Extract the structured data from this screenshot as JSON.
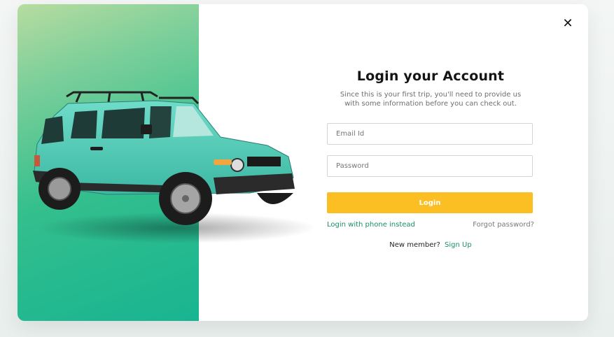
{
  "modal": {
    "close_icon": "close-icon",
    "title": "Login your Account",
    "subtitle": "Since this is your first trip, you'll need to provide us with some information before you can check out.",
    "email_placeholder": "Email Id",
    "email_value": "",
    "password_placeholder": "Password",
    "password_value": "",
    "login_label": "Login",
    "phone_login_label": "Login with phone instead",
    "forgot_label": "Forgot password?",
    "new_member_label": "New member?",
    "signup_label": "Sign Up"
  },
  "colors": {
    "accent_green": "#1c8f62",
    "panel_gradient": [
      "#b7dca0",
      "#34bf8d",
      "#18b491"
    ],
    "login_button": "#fbbf24",
    "car_body": "#4fcfb9"
  },
  "image": {
    "hero": "teal-suv-car"
  }
}
